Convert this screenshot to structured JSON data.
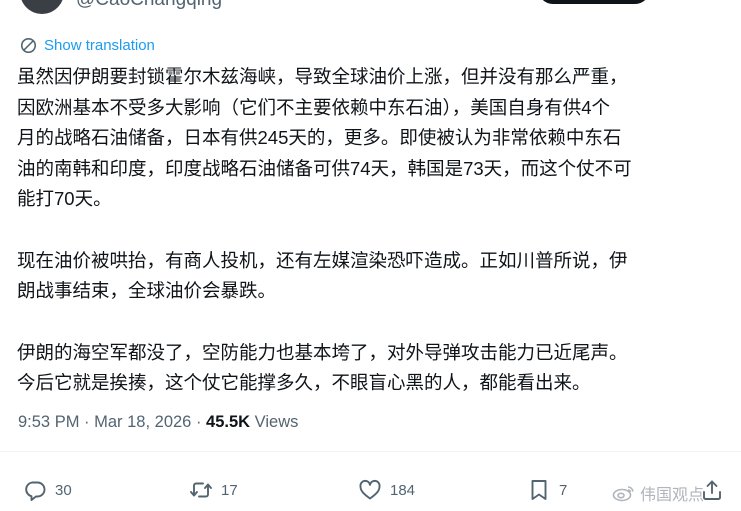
{
  "author": {
    "handle": "@CaoChangqing"
  },
  "translation": {
    "label": "Show translation"
  },
  "tweet": {
    "paragraphs": [
      "虽然因伊朗要封锁霍尔木兹海峡，导致全球油价上涨，但并没有那么严重，\n因欧洲基本不受多大影响（它们不主要依赖中东石油），美国自身有供4个\n月的战略石油储备，日本有供245天的，更多。即使被认为非常依赖中东石\n油的南韩和印度，印度战略石油储备可供74天，韩国是73天，而这个仗不可\n能打70天。",
      "现在油价被哄抬，有商人投机，还有左媒渲染恐吓造成。正如川普所说，伊\n朗战事结束，全球油价会暴跌。",
      "伊朗的海空军都没了，空防能力也基本垮了，对外导弹攻击能力已近尾声。\n今后它就是挨揍，这个仗它能撑多久，不眼盲心黑的人，都能看出来。"
    ]
  },
  "meta": {
    "time": "9:53 PM",
    "separator1": " · ",
    "date": "Mar 18, 2026",
    "separator2": " · ",
    "views_count": "45.5K",
    "views_label": " Views"
  },
  "actions": {
    "replies": "30",
    "retweets": "17",
    "likes": "184",
    "bookmarks": "7"
  },
  "watermark": {
    "text": "伟国观点"
  },
  "colors": {
    "link": "#1d9bf0",
    "text": "#0f1419",
    "secondary": "#536471"
  }
}
